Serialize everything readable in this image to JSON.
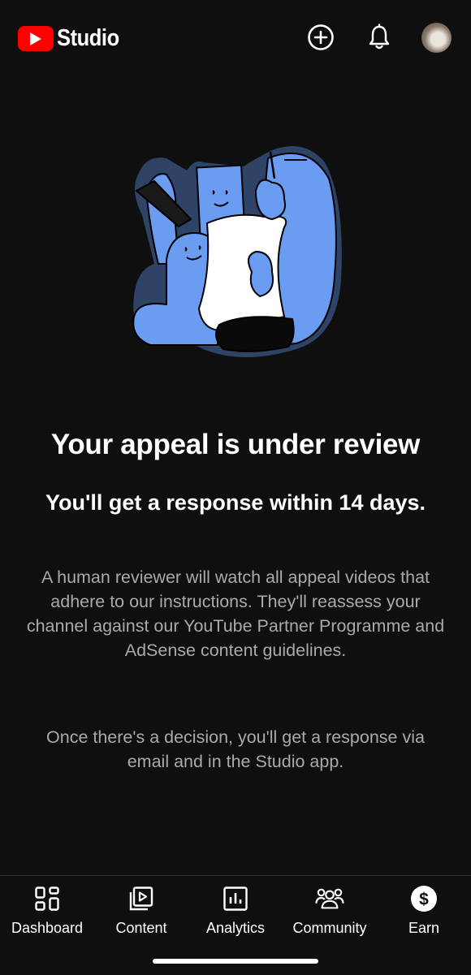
{
  "header": {
    "logo_text": "Studio",
    "create_icon": "plus-circle-icon",
    "notifications_icon": "bell-icon",
    "account_icon": "avatar"
  },
  "main": {
    "title": "Your appeal is under review",
    "subtitle": "You'll get a response within 14 days.",
    "paragraph_1": "A human reviewer will watch all appeal videos that adhere to our instructions. They'll reassess your channel against our YouTube Partner Programme and AdSense content guidelines.",
    "paragraph_2": "Once there's a decision, you'll get a response via email and in the Studio app."
  },
  "tabs": [
    {
      "label": "Dashboard",
      "icon": "dashboard-icon"
    },
    {
      "label": "Content",
      "icon": "content-icon"
    },
    {
      "label": "Analytics",
      "icon": "analytics-icon"
    },
    {
      "label": "Community",
      "icon": "community-icon"
    },
    {
      "label": "Earn",
      "icon": "earn-icon"
    }
  ],
  "colors": {
    "background": "#0f0f0f",
    "brand_red": "#ff0000",
    "text_primary": "#ffffff",
    "text_secondary": "#aaaaaa",
    "illustration_blue": "#6a9cf2"
  }
}
